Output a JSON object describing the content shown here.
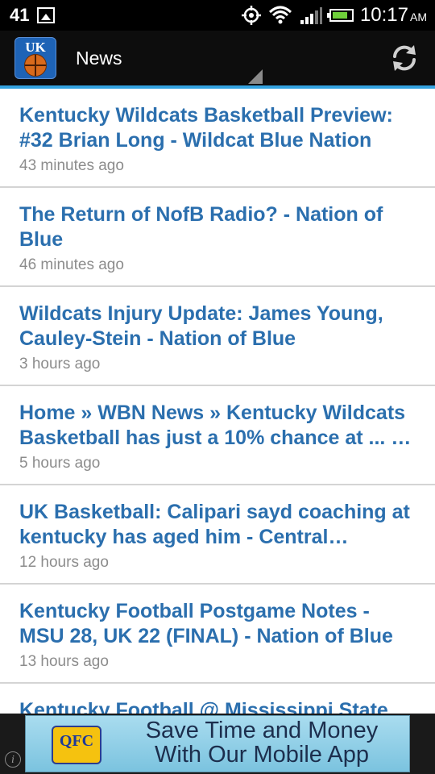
{
  "status_bar": {
    "notification_count": "41",
    "time": "10:17",
    "ampm": "AM"
  },
  "action_bar": {
    "title": "News",
    "app_icon_text": "UK"
  },
  "news_items": [
    {
      "title": "Kentucky Wildcats Basketball Preview: #32 Brian Long - Wildcat Blue Nation",
      "time": "43 minutes ago"
    },
    {
      "title": "The Return of NofB Radio? - Nation of Blue",
      "time": "46 minutes ago"
    },
    {
      "title": "Wildcats Injury Update: James Young, Cauley-Stein - Nation of Blue",
      "time": "3 hours ago"
    },
    {
      "title": "Home » WBN News » Kentucky Wildcats Basketball has just a 10% chance at ... …",
      "time": "5 hours ago"
    },
    {
      "title": "UK Basketball: Calipari sayd coaching at kentucky has aged him - Central…",
      "time": "12 hours ago"
    },
    {
      "title": "Kentucky Football Postgame Notes - MSU 28, UK 22 (FINAL) - Nation of Blue",
      "time": "13 hours ago"
    },
    {
      "title": "Kentucky Football @ Mississippi State",
      "time": ""
    }
  ],
  "ad": {
    "logo_text": "QFC",
    "line1": "Save Time and Money",
    "line2": "With Our Mobile App"
  },
  "colors": {
    "accent": "#33a2e0",
    "headline": "#2b6fae",
    "timestamp": "#8c8c8c"
  }
}
